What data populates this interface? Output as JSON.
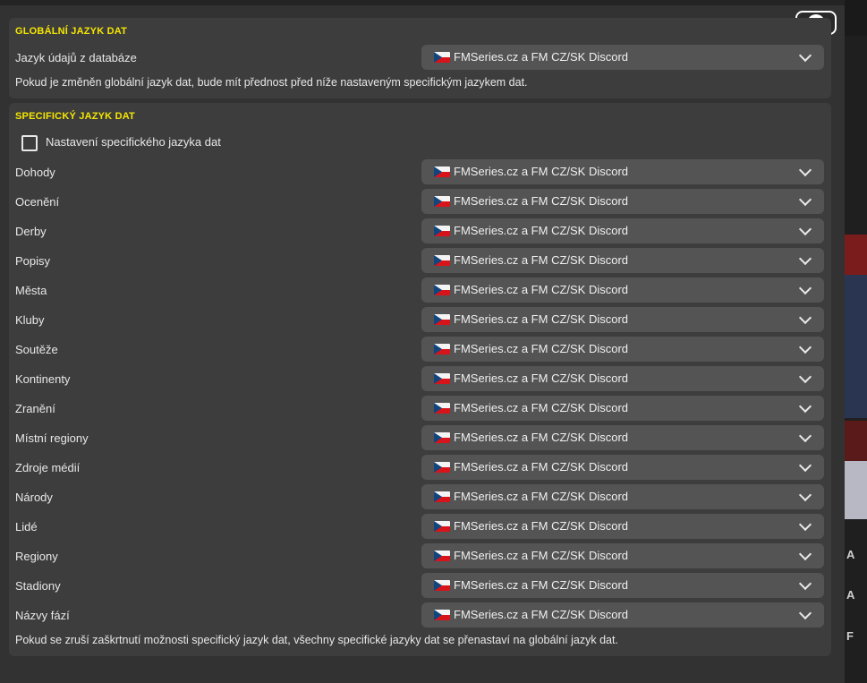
{
  "close_button": {
    "icon": "close-icon"
  },
  "global_section": {
    "title": "GLOBÁLNÍ JAZYK DAT",
    "label": "Jazyk údajů z databáze",
    "value": "FMSeries.cz a FM CZ/SK Discord",
    "flag_icon": "czech-flag-icon",
    "note": "Pokud je změněn globální jazyk dat, bude mít přednost před níže nastaveným specifickým jazykem dat."
  },
  "specific_section": {
    "title": "SPECIFICKÝ JAZYK DAT",
    "checkbox_label": "Nastavení specifického jazyka dat",
    "checkbox_checked": false,
    "rows": [
      {
        "label": "Dohody",
        "value": "FMSeries.cz a FM CZ/SK Discord"
      },
      {
        "label": "Ocenění",
        "value": "FMSeries.cz a FM CZ/SK Discord"
      },
      {
        "label": "Derby",
        "value": "FMSeries.cz a FM CZ/SK Discord"
      },
      {
        "label": "Popisy",
        "value": "FMSeries.cz a FM CZ/SK Discord"
      },
      {
        "label": "Města",
        "value": "FMSeries.cz a FM CZ/SK Discord"
      },
      {
        "label": "Kluby",
        "value": "FMSeries.cz a FM CZ/SK Discord"
      },
      {
        "label": "Soutěže",
        "value": "FMSeries.cz a FM CZ/SK Discord"
      },
      {
        "label": "Kontinenty",
        "value": "FMSeries.cz a FM CZ/SK Discord"
      },
      {
        "label": "Zranění",
        "value": "FMSeries.cz a FM CZ/SK Discord"
      },
      {
        "label": "Místní regiony",
        "value": "FMSeries.cz a FM CZ/SK Discord"
      },
      {
        "label": "Zdroje médií",
        "value": "FMSeries.cz a FM CZ/SK Discord"
      },
      {
        "label": "Národy",
        "value": "FMSeries.cz a FM CZ/SK Discord"
      },
      {
        "label": "Lidé",
        "value": "FMSeries.cz a FM CZ/SK Discord"
      },
      {
        "label": "Regiony",
        "value": "FMSeries.cz a FM CZ/SK Discord"
      },
      {
        "label": "Stadiony",
        "value": "FMSeries.cz a FM CZ/SK Discord"
      },
      {
        "label": "Názvy fází",
        "value": "FMSeries.cz a FM CZ/SK Discord"
      }
    ],
    "note": "Pokud se zruší zaškrtnutí možnosti specifický jazyk dat, všechny specifické jazyky dat se přenastaví na globální jazyk dat."
  },
  "background_strip": {
    "letters": [
      "A",
      "A",
      "F"
    ]
  },
  "colors": {
    "accent_title": "#f5e600",
    "panel": "#3d3d3d",
    "dropdown": "#545454"
  }
}
